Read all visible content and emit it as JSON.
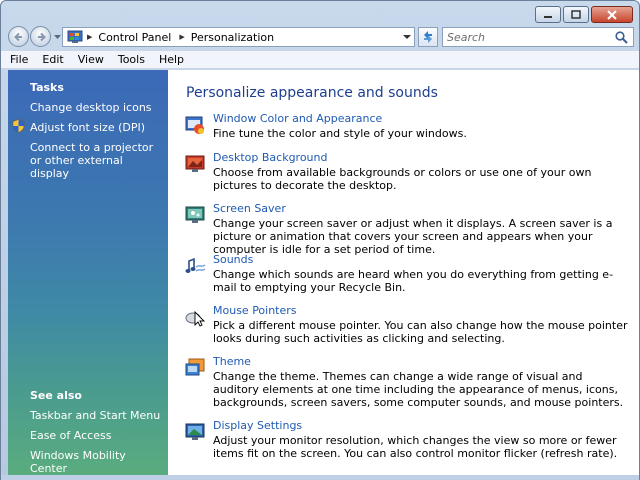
{
  "window": {
    "caption_buttons": {
      "minimize_icon": "minimize-icon",
      "maximize_icon": "maximize-icon",
      "close_icon": "close-icon"
    }
  },
  "nav": {
    "breadcrumbs": [
      "Control Panel",
      "Personalization"
    ],
    "search_placeholder": "Search"
  },
  "menubar": {
    "items": [
      "File",
      "Edit",
      "View",
      "Tools",
      "Help"
    ]
  },
  "sidebar": {
    "tasks_heading": "Tasks",
    "tasks": [
      "Change desktop icons",
      "Adjust font size (DPI)",
      "Connect to a projector or other external display"
    ],
    "see_also_heading": "See also",
    "see_also": [
      "Taskbar and Start Menu",
      "Ease of Access",
      "Windows Mobility Center"
    ]
  },
  "main": {
    "title": "Personalize appearance and sounds",
    "items": [
      {
        "title": "Window Color and Appearance",
        "desc": "Fine tune the color and style of your windows.",
        "icon": "window-color-icon"
      },
      {
        "title": "Desktop Background",
        "desc": "Choose from available backgrounds or colors or use one of your own pictures to decorate the desktop.",
        "icon": "desktop-background-icon"
      },
      {
        "title": "Screen Saver",
        "desc": "Change your screen saver or adjust when it displays. A screen saver is a picture or animation that covers your screen and appears when your computer is idle for a set period of time.",
        "icon": "screen-saver-icon"
      },
      {
        "title": "Sounds",
        "desc": "Change which sounds are heard when you do everything from getting e-mail to emptying your Recycle Bin.",
        "icon": "sounds-icon"
      },
      {
        "title": "Mouse Pointers",
        "desc": "Pick a different mouse pointer. You can also change how the mouse pointer looks during such activities as clicking and selecting.",
        "icon": "mouse-pointer-icon"
      },
      {
        "title": "Theme",
        "desc": "Change the theme. Themes can change a wide range of visual and auditory elements at one time including the appearance of menus, icons, backgrounds, screen savers, some computer sounds, and mouse pointers.",
        "icon": "theme-icon"
      },
      {
        "title": "Display Settings",
        "desc": "Adjust your monitor resolution, which changes the view so more or fewer items fit on the screen. You can also control monitor flicker (refresh rate).",
        "icon": "display-settings-icon"
      }
    ]
  },
  "colors": {
    "link": "#1f5ab4",
    "title": "#1e3f8f",
    "sidebar_top": "#3b69b7",
    "sidebar_bottom": "#5aac7e"
  }
}
